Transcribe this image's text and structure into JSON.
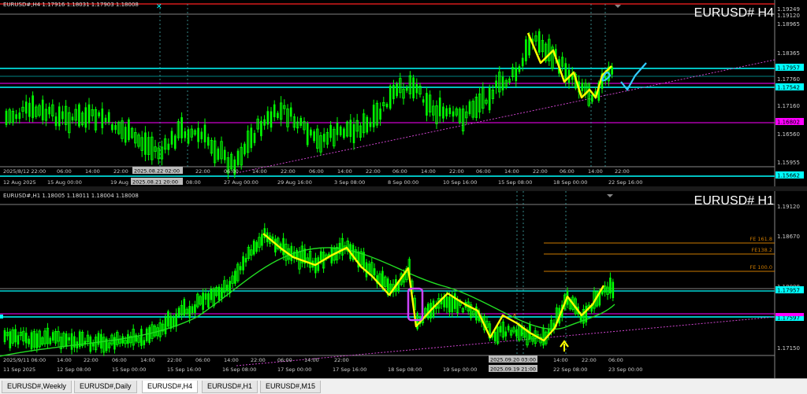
{
  "top_chart": {
    "header": "EURUSD#,H4  1.17916 1.18031 1.17903 1.18008",
    "title": "EURUSD# H4",
    "price_labels": [
      "1.19249",
      "1.19120",
      "1.18965",
      "1.18365",
      "1.17957",
      "1.17760",
      "1.17542",
      "1.17160",
      "1.16802",
      "1.16560",
      "1.15955",
      "1.15662"
    ],
    "time_labels": [
      "2025/8/12 22:00",
      "06:00",
      "14:00",
      "22:00",
      "2025.08.22 02:00",
      "22:00",
      "06:00",
      "14:00",
      "22:00",
      "06:00",
      "14:00",
      "22:00",
      "06:00",
      "14:00",
      "22:00",
      "06:00",
      "14:00",
      "22:00",
      "06:00",
      "14:00",
      "22:00"
    ],
    "time_labels2": [
      "12 Aug 2025",
      "15 Aug 00:00",
      "19 Aug",
      "2025.08.21 20:00",
      "08:00",
      "27 Aug 00:00",
      "29 Aug 16:00",
      "3 Sep 08:00",
      "8 Sep 00:00",
      "10 Sep 16:00",
      "15 Sep 08:00",
      "18 Sep 00:00",
      "22 Sep 16:00"
    ]
  },
  "bottom_chart": {
    "header": "EURUSD#,H1  1.18005 1.18011 1.18004 1.18008",
    "title": "EURUSD# H1",
    "price_labels": [
      "1.19120",
      "1.18670",
      "1.18008",
      "1.17957",
      "1.17597",
      "1.17150"
    ],
    "fe_labels": [
      "FE 161.8",
      "FE138.2",
      "FE 100.0"
    ],
    "time_labels": [
      "2025/9/11 06:00",
      "14:00",
      "22:00",
      "06:00",
      "14:00",
      "22:00",
      "06:00",
      "14:00",
      "22:00",
      "06:00",
      "14:00",
      "22:00",
      "2025.09.20 03:00",
      "14:00",
      "22:00",
      "06:00"
    ],
    "time_labels2": [
      "11 Sep 2025",
      "12 Sep 08:00",
      "15 Sep 00:00",
      "15 Sep 16:00",
      "16 Sep 08:00",
      "17 Sep 00:00",
      "17 Sep 16:00",
      "18 Sep 08:00",
      "19 Sep 00:00",
      "2025.09.19 21:00",
      "22 Sep 08:00",
      "23 Sep 00:00"
    ]
  },
  "tabs": [
    "EURUSD#,Weekly",
    "EURUSD#,Daily",
    "EURUSD#,H4",
    "EURUSD#,H1",
    "EURUSD#,M15"
  ],
  "active_tab": "EURUSD#,H4",
  "colors": {
    "bg": "#000000",
    "candle": "#00ff00",
    "cyan": "#00ffff",
    "magenta": "#ff00ff",
    "yellow": "#ffff00",
    "fe": "#cc7a00"
  }
}
